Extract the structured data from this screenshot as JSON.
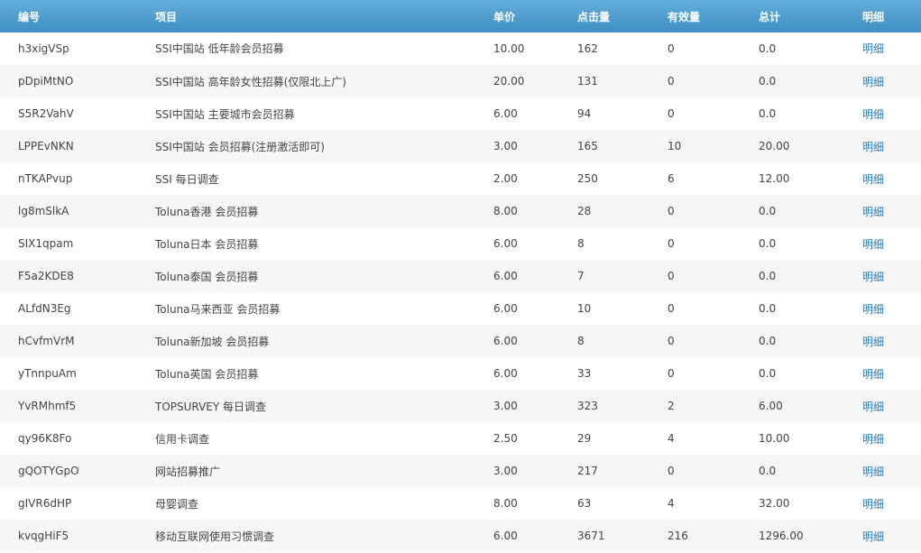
{
  "headers": {
    "id": "编号",
    "project": "项目",
    "price": "单价",
    "clicks": "点击量",
    "valid": "有效量",
    "total": "总计",
    "detail": "明细"
  },
  "rows": [
    {
      "id": "h3xigVSp",
      "project": "SSI中国站 低年龄会员招募",
      "price": "10.00",
      "clicks": "162",
      "valid": "0",
      "total": "0.0",
      "detail": "明细"
    },
    {
      "id": "pDpiMtNO",
      "project": "SSI中国站 高年龄女性招募(仅限北上广)",
      "price": "20.00",
      "clicks": "131",
      "valid": "0",
      "total": "0.0",
      "detail": "明细"
    },
    {
      "id": "S5R2VahV",
      "project": "SSI中国站 主要城市会员招募",
      "price": "6.00",
      "clicks": "94",
      "valid": "0",
      "total": "0.0",
      "detail": "明细"
    },
    {
      "id": "LPPEvNKN",
      "project": "SSI中国站 会员招募(注册激活即可)",
      "price": "3.00",
      "clicks": "165",
      "valid": "10",
      "total": "20.00",
      "detail": "明细"
    },
    {
      "id": "nTKAPvup",
      "project": "SSI 每日调查",
      "price": "2.00",
      "clicks": "250",
      "valid": "6",
      "total": "12.00",
      "detail": "明细"
    },
    {
      "id": "lg8mSlkA",
      "project": "Toluna香港 会员招募",
      "price": "8.00",
      "clicks": "28",
      "valid": "0",
      "total": "0.0",
      "detail": "明细"
    },
    {
      "id": "SIX1qpam",
      "project": "Toluna日本 会员招募",
      "price": "6.00",
      "clicks": "8",
      "valid": "0",
      "total": "0.0",
      "detail": "明细"
    },
    {
      "id": "F5a2KDE8",
      "project": "Toluna泰国 会员招募",
      "price": "6.00",
      "clicks": "7",
      "valid": "0",
      "total": "0.0",
      "detail": "明细"
    },
    {
      "id": "ALfdN3Eg",
      "project": "Toluna马来西亚 会员招募",
      "price": "6.00",
      "clicks": "10",
      "valid": "0",
      "total": "0.0",
      "detail": "明细"
    },
    {
      "id": "hCvfmVrM",
      "project": "Toluna新加坡 会员招募",
      "price": "6.00",
      "clicks": "8",
      "valid": "0",
      "total": "0.0",
      "detail": "明细"
    },
    {
      "id": "yTnnpuAm",
      "project": "Toluna英国 会员招募",
      "price": "6.00",
      "clicks": "33",
      "valid": "0",
      "total": "0.0",
      "detail": "明细"
    },
    {
      "id": "YvRMhmf5",
      "project": "TOPSURVEY 每日调查",
      "price": "3.00",
      "clicks": "323",
      "valid": "2",
      "total": "6.00",
      "detail": "明细"
    },
    {
      "id": "qy96K8Fo",
      "project": "信用卡调查",
      "price": "2.50",
      "clicks": "29",
      "valid": "4",
      "total": "10.00",
      "detail": "明细"
    },
    {
      "id": "gQOTYGpO",
      "project": "网站招募推广",
      "price": "3.00",
      "clicks": "217",
      "valid": "0",
      "total": "0.0",
      "detail": "明细"
    },
    {
      "id": "gIVR6dHP",
      "project": "母婴调查",
      "price": "8.00",
      "clicks": "63",
      "valid": "4",
      "total": "32.00",
      "detail": "明细"
    },
    {
      "id": "kvqgHiF5",
      "project": "移动互联网使用习惯调查",
      "price": "6.00",
      "clicks": "3671",
      "valid": "216",
      "total": "1296.00",
      "detail": "明细"
    }
  ],
  "colors": {
    "header_gradient_top": "#62aedb",
    "header_gradient_bottom": "#3f8fc4",
    "link": "#2a7ec1",
    "row_alt": "#f6f6f6"
  }
}
